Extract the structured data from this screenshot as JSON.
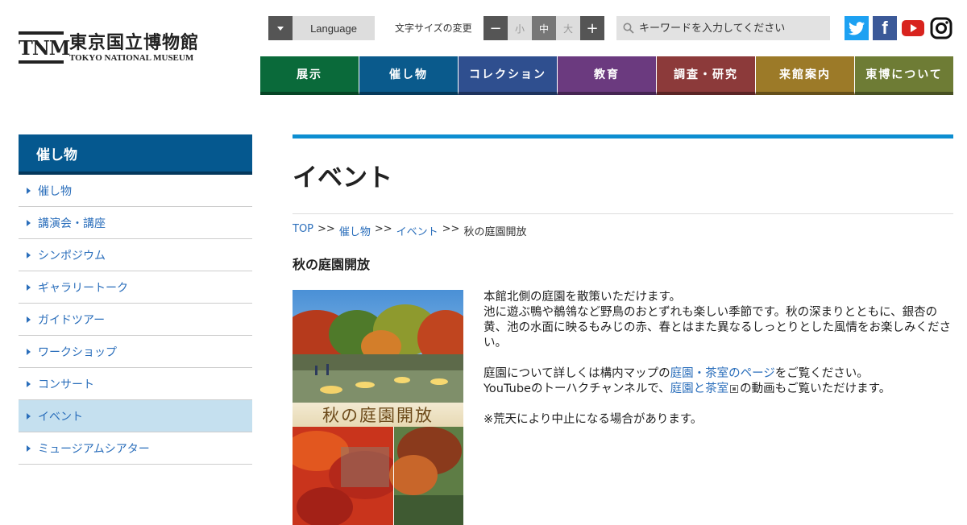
{
  "logo": {
    "mark": "TNM",
    "name_jp": "東京国立博物館",
    "name_en": "TOKYO NATIONAL MUSEUM"
  },
  "utility": {
    "language_label": "Language",
    "font_size_label": "文字サイズの変更",
    "font_size_minus": "−",
    "font_size_small": "小",
    "font_size_mid": "中",
    "font_size_large": "大",
    "font_size_plus": "+",
    "search_placeholder": "キーワードを入力してください"
  },
  "social": {
    "facebook_glyph": "f"
  },
  "nav": [
    {
      "label": "展示",
      "color": "#0a6a3a"
    },
    {
      "label": "催し物",
      "color": "#0a5a8c"
    },
    {
      "label": "コレクション",
      "color": "#2f4f8f"
    },
    {
      "label": "教育",
      "color": "#6b3a7f"
    },
    {
      "label": "調査・研究",
      "color": "#8c3a3a"
    },
    {
      "label": "来館案内",
      "color": "#9c7a28"
    },
    {
      "label": "東博について",
      "color": "#6e7c35"
    }
  ],
  "sidebar": {
    "heading": "催し物",
    "items": [
      {
        "label": "催し物"
      },
      {
        "label": "講演会・講座"
      },
      {
        "label": "シンポジウム"
      },
      {
        "label": "ギャラリートーク"
      },
      {
        "label": "ガイドツアー"
      },
      {
        "label": "ワークショップ"
      },
      {
        "label": "コンサート"
      },
      {
        "label": "イベント",
        "active": true
      },
      {
        "label": "ミュージアムシアター"
      }
    ]
  },
  "main": {
    "title": "イベント",
    "breadcrumb": {
      "top": "TOP",
      "sep": ">>",
      "events": "催し物",
      "event": "イベント",
      "current": "秋の庭園開放"
    },
    "subtitle": "秋の庭園開放",
    "poster_caption": "秋の庭園開放",
    "paragraph1": "本館北側の庭園を散策いただけます。\n池に遊ぶ鴨や鶺鴒など野鳥のおとずれも楽しい季節です。秋の深まりとともに、銀杏の黄、池の水面に映るもみじの赤、春とはまた異なるしっとりとした風情をお楽しみください。",
    "p2_pre": "庭園について詳しくは構内マップの",
    "p2_link": "庭園・茶室のページ",
    "p2_post": "をご覧ください。",
    "p3_pre": "YouTubeのトーハクチャンネルで、",
    "p3_link": "庭園と茶室",
    "p3_post": "の動画もご覧いただけます。",
    "notice": "※荒天により中止になる場合があります。"
  }
}
